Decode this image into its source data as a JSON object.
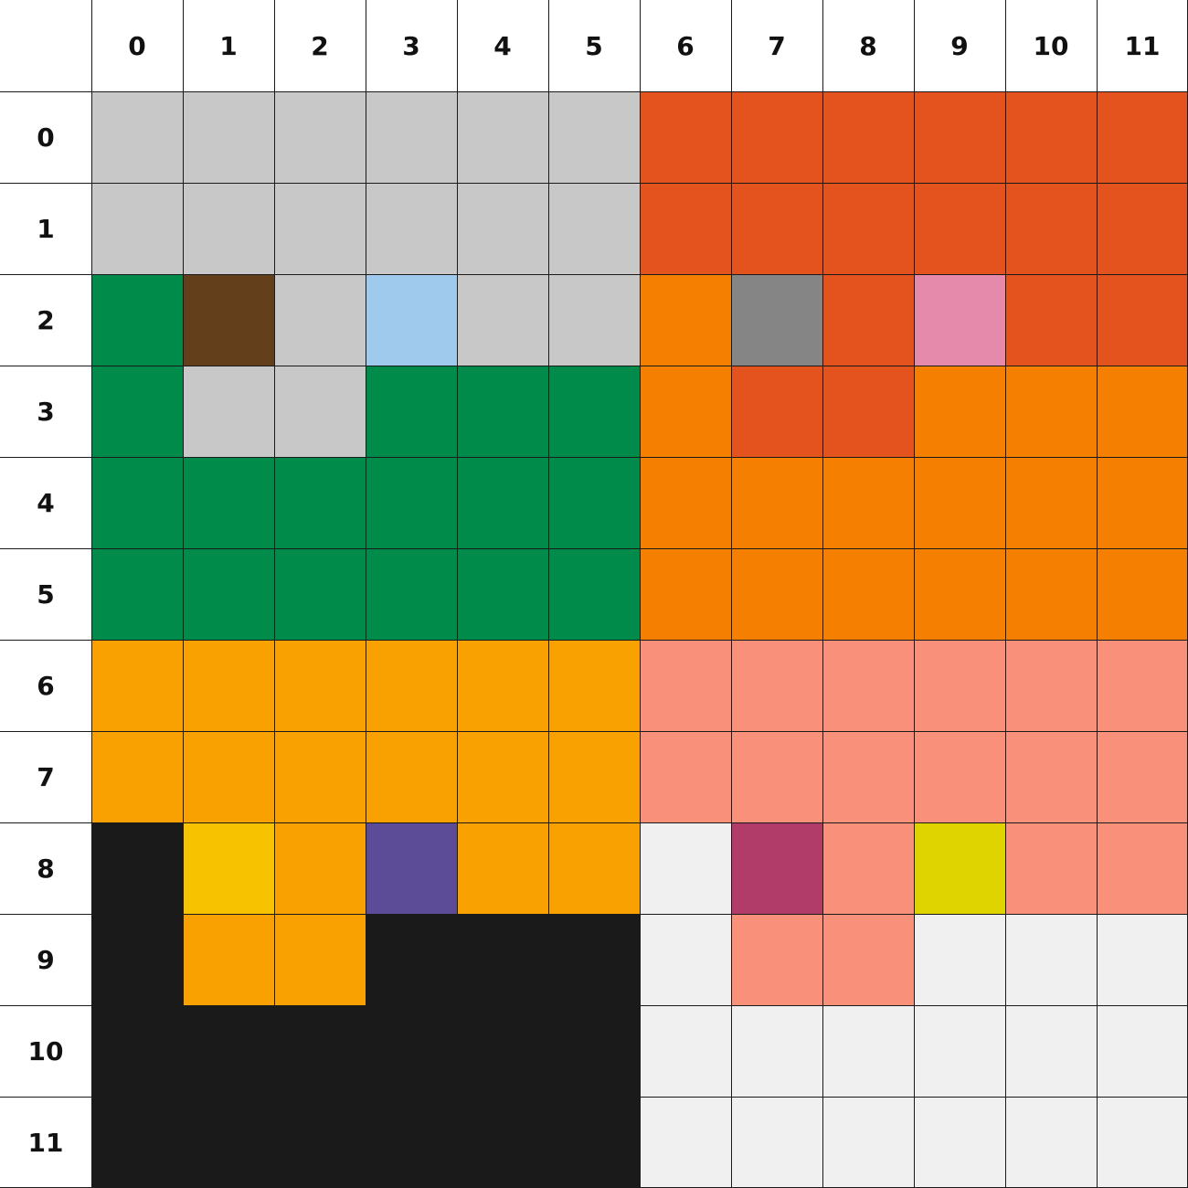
{
  "grid": {
    "columns": [
      "0",
      "1",
      "2",
      "3",
      "4",
      "5",
      "6",
      "7",
      "8",
      "9",
      "10",
      "11"
    ],
    "rows": [
      "0",
      "1",
      "2",
      "3",
      "4",
      "5",
      "6",
      "7",
      "8",
      "9",
      "10",
      "11"
    ],
    "palette": {
      "G": "#c8c8c8",
      "R": "#e4531e",
      "O": "#f57f00",
      "N": "#008b4a",
      "B": "#633f1c",
      "L": "#a0c9ee",
      "D": "#858585",
      "P": "#e68aab",
      "A": "#f9a100",
      "S": "#f8907a",
      "K": "#1a1a1a",
      "Y": "#f7c200",
      "V": "#5c4b96",
      "W": "#f0f0f0",
      "M": "#b13c6a",
      "C": "#dfd300"
    },
    "cells": [
      [
        "G",
        "G",
        "G",
        "G",
        "G",
        "G",
        "R",
        "R",
        "R",
        "R",
        "R",
        "R"
      ],
      [
        "G",
        "G",
        "G",
        "G",
        "G",
        "G",
        "R",
        "R",
        "R",
        "R",
        "R",
        "R"
      ],
      [
        "N",
        "B",
        "G",
        "L",
        "G",
        "G",
        "O",
        "D",
        "R",
        "P",
        "R",
        "R"
      ],
      [
        "N",
        "G",
        "G",
        "N",
        "N",
        "N",
        "O",
        "R",
        "R",
        "O",
        "O",
        "O"
      ],
      [
        "N",
        "N",
        "N",
        "N",
        "N",
        "N",
        "O",
        "O",
        "O",
        "O",
        "O",
        "O"
      ],
      [
        "N",
        "N",
        "N",
        "N",
        "N",
        "N",
        "O",
        "O",
        "O",
        "O",
        "O",
        "O"
      ],
      [
        "A",
        "A",
        "A",
        "A",
        "A",
        "A",
        "S",
        "S",
        "S",
        "S",
        "S",
        "S"
      ],
      [
        "A",
        "A",
        "A",
        "A",
        "A",
        "A",
        "S",
        "S",
        "S",
        "S",
        "S",
        "S"
      ],
      [
        "K",
        "Y",
        "A",
        "V",
        "A",
        "A",
        "W",
        "M",
        "S",
        "C",
        "S",
        "S"
      ],
      [
        "K",
        "A",
        "A",
        "K",
        "K",
        "K",
        "W",
        "S",
        "S",
        "W",
        "W",
        "W"
      ],
      [
        "K",
        "K",
        "K",
        "K",
        "K",
        "K",
        "W",
        "W",
        "W",
        "W",
        "W",
        "W"
      ],
      [
        "K",
        "K",
        "K",
        "K",
        "K",
        "K",
        "W",
        "W",
        "W",
        "W",
        "W",
        "W"
      ]
    ]
  }
}
